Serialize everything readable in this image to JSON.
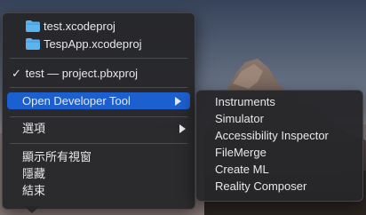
{
  "menu": {
    "projects": [
      {
        "label": "test.xcodeproj",
        "icon": "folder-icon"
      },
      {
        "label": "TespApp.xcodeproj",
        "icon": "folder-icon"
      }
    ],
    "current_window": {
      "check": "✓",
      "label": "test — project.pbxproj"
    },
    "open_developer_tool": "Open Developer Tool",
    "options": "選項",
    "show_all_windows": "顯示所有視窗",
    "hide": "隱藏",
    "quit": "結束"
  },
  "submenu": {
    "items": [
      "Instruments",
      "Simulator",
      "Accessibility Inspector",
      "FileMerge",
      "Create ML",
      "Reality Composer"
    ]
  },
  "colors": {
    "highlight": "#1c5fce",
    "folder": "#5ab4f0",
    "menu_bg": "#26262a"
  }
}
